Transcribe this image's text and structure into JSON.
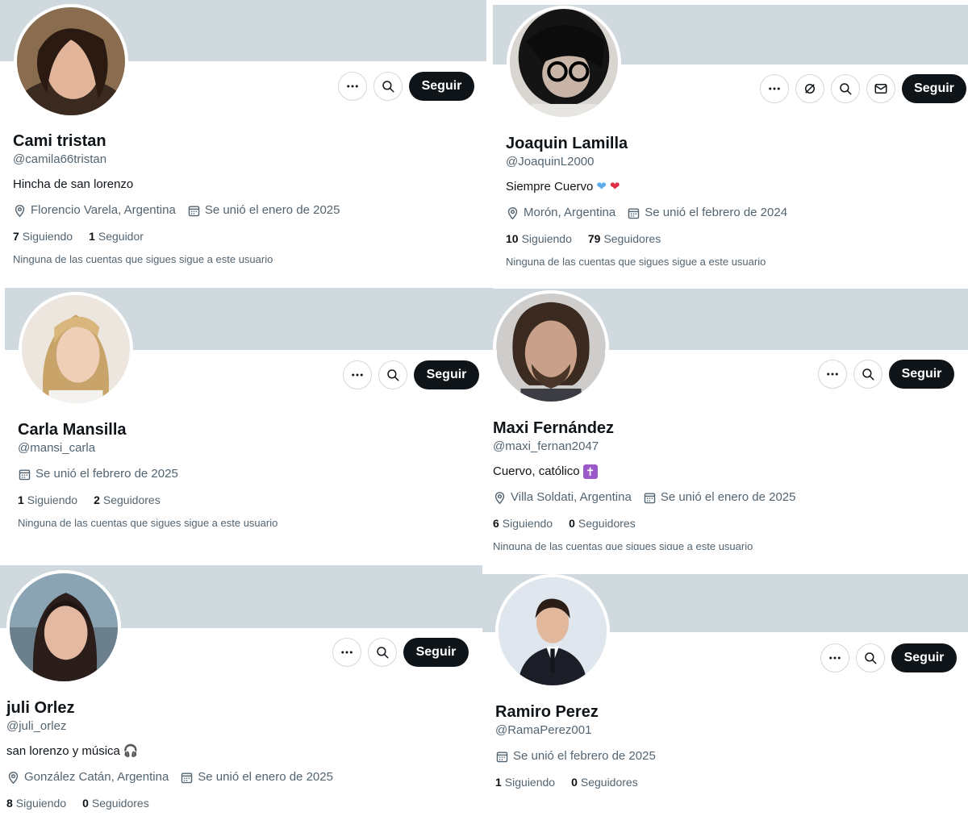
{
  "colors": {
    "banner": "#cfd9de",
    "follow_bg": "#0f1419",
    "secondary_text": "#536471"
  },
  "profiles": [
    {
      "name": "Cami tristan",
      "handle": "@camila66tristan",
      "bio": "Hincha de san lorenzo",
      "location": "Florencio Varela, Argentina",
      "joined": "Se unió el enero de 2025",
      "following_count": "7",
      "following_label": "Siguiendo",
      "followers_count": "1",
      "followers_label": "Seguidor",
      "mutual_text": "Ninguna de las cuentas que sigues sigue a este usuario",
      "follow_label": "Seguir",
      "icons": [
        "more-icon",
        "search-icon"
      ]
    },
    {
      "name": "Joaquin Lamilla",
      "handle": "@JoaquinL2000",
      "bio": "Siempre Cuervo",
      "bio_emoji": [
        "blue-heart-icon",
        "red-heart-icon"
      ],
      "location": "Morón, Argentina",
      "joined": "Se unió el febrero de 2024",
      "following_count": "10",
      "following_label": "Siguiendo",
      "followers_count": "79",
      "followers_label": "Seguidores",
      "mutual_text": "Ninguna de las cuentas que sigues sigue a este usuario",
      "follow_label": "Seguir",
      "icons": [
        "more-icon",
        "grok-icon",
        "search-icon",
        "message-icon"
      ]
    },
    {
      "name": "Carla Mansilla",
      "handle": "@mansi_carla",
      "joined": "Se unió el febrero de 2025",
      "following_count": "1",
      "following_label": "Siguiendo",
      "followers_count": "2",
      "followers_label": "Seguidores",
      "mutual_text": "Ninguna de las cuentas que sigues sigue a este usuario",
      "follow_label": "Seguir",
      "icons": [
        "more-icon",
        "search-icon"
      ]
    },
    {
      "name": "Maxi Fernández",
      "handle": "@maxi_fernan2047",
      "bio": "Cuervo, católico",
      "bio_emoji": [
        "latin-cross-icon"
      ],
      "location": "Villa Soldati, Argentina",
      "joined": "Se unió el enero de 2025",
      "following_count": "6",
      "following_label": "Siguiendo",
      "followers_count": "0",
      "followers_label": "Seguidores",
      "mutual_text": "Ninguna de las cuentas que sigues sigue a este usuario",
      "follow_label": "Seguir",
      "icons": [
        "more-icon",
        "search-icon"
      ]
    },
    {
      "name": "juli Orlez",
      "handle": "@juli_orlez",
      "bio": "san lorenzo y música",
      "bio_emoji": [
        "headphones-icon"
      ],
      "location": "González Catán, Argentina",
      "joined": "Se unió el enero de 2025",
      "following_count": "8",
      "following_label": "Siguiendo",
      "followers_count": "0",
      "followers_label": "Seguidores",
      "follow_label": "Seguir",
      "icons": [
        "more-icon",
        "search-icon"
      ]
    },
    {
      "name": "Ramiro Perez",
      "handle": "@RamaPerez001",
      "joined": "Se unió el febrero de 2025",
      "following_count": "1",
      "following_label": "Siguiendo",
      "followers_count": "0",
      "followers_label": "Seguidores",
      "follow_label": "Seguir",
      "icons": [
        "more-icon",
        "search-icon"
      ]
    }
  ]
}
